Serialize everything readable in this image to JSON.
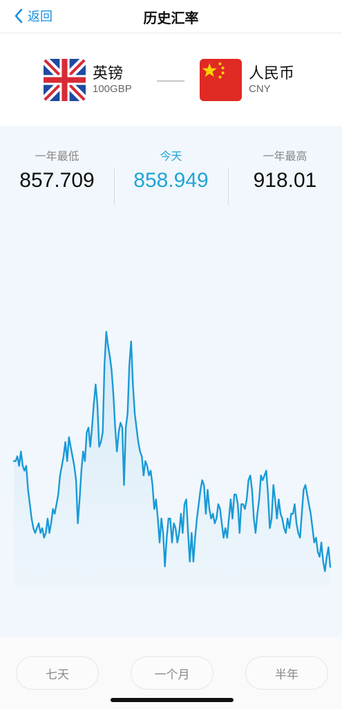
{
  "nav": {
    "back_label": "返回",
    "title": "历史汇率"
  },
  "from_currency": {
    "name": "英镑",
    "code": "100GBP",
    "flag": "uk-flag-icon"
  },
  "to_currency": {
    "name": "人民币",
    "code": "CNY",
    "flag": "china-flag-icon"
  },
  "stats": {
    "low_label": "一年最低",
    "low_value": "857.709",
    "today_label": "今天",
    "today_value": "858.949",
    "high_label": "一年最高",
    "high_value": "918.01"
  },
  "colors": {
    "accent": "#21a4d6",
    "line": "#1a9ad6",
    "panel_bg": "#f1f7fc",
    "back_blue": "#1a8fe0"
  },
  "chart_data": {
    "type": "line",
    "title": "",
    "xlabel": "",
    "ylabel": "",
    "ylim": [
      857.709,
      918.01
    ],
    "series": [
      {
        "values": [
          881,
          881,
          882,
          880,
          883,
          880,
          879,
          880,
          875,
          872,
          869,
          867,
          866,
          867,
          868,
          866,
          867,
          865,
          866,
          869,
          866,
          868,
          871,
          870,
          872,
          874,
          878,
          880,
          882,
          885,
          881,
          886,
          884,
          882,
          880,
          877,
          868,
          873,
          879,
          883,
          881,
          887,
          888,
          884,
          888,
          893,
          897,
          893,
          884,
          885,
          887,
          901,
          908,
          905,
          903,
          900,
          895,
          888,
          883,
          887,
          889,
          888,
          876,
          888,
          891,
          901,
          906,
          897,
          891,
          888,
          885,
          883,
          882,
          878,
          881,
          880,
          878,
          879,
          876,
          871,
          873,
          869,
          864,
          869,
          866,
          859,
          865,
          869,
          869,
          864,
          868,
          867,
          864,
          866,
          870,
          866,
          872,
          873,
          866,
          860,
          866,
          860,
          865,
          869,
          872,
          875,
          877,
          876,
          870,
          875,
          871,
          869,
          870,
          868,
          869,
          872,
          871,
          868,
          865,
          867,
          865,
          869,
          873,
          869,
          874,
          874,
          872,
          866,
          872,
          872,
          871,
          873,
          877,
          878,
          875,
          869,
          866,
          870,
          873,
          878,
          877,
          878,
          879,
          874,
          867,
          869,
          876,
          873,
          869,
          873,
          870,
          869,
          867,
          866,
          869,
          867,
          870,
          870,
          872,
          868,
          866,
          865,
          870,
          875,
          876,
          874,
          872,
          870,
          867,
          864,
          865,
          862,
          861,
          864,
          860,
          858,
          861,
          863,
          858.9
        ]
      }
    ]
  }
}
